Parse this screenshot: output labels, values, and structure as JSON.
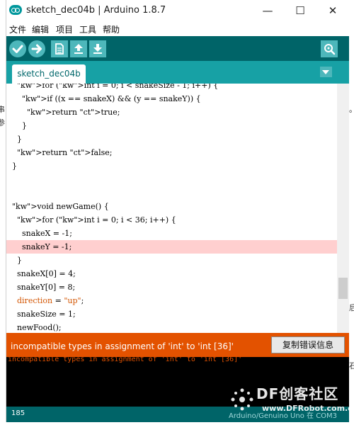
{
  "window": {
    "title": "sketch_dec04b | Arduino 1.8.7",
    "minimize_glyph": "—",
    "maximize_glyph": "☐",
    "close_glyph": "✕"
  },
  "menu": [
    "文件",
    "编辑",
    "项目",
    "工具",
    "帮助"
  ],
  "toolbar": {
    "icons": [
      "verify-icon",
      "upload-icon",
      "new-icon",
      "open-icon",
      "save-icon",
      "serial-monitor-icon"
    ],
    "accent_color": "#4db7bb",
    "background_color": "#006468"
  },
  "tab": {
    "label": "sketch_dec04b"
  },
  "editor": {
    "lines": [
      {
        "text": "  for (int i = 0; i < snakeSize - 1; i++) {",
        "highlight": false
      },
      {
        "text": "    if ((x == snakeX) && (y == snakeY)) {",
        "highlight": false
      },
      {
        "text": "      return true;",
        "highlight": false
      },
      {
        "text": "    }",
        "highlight": false
      },
      {
        "text": "  }",
        "highlight": false
      },
      {
        "text": "  return false;",
        "highlight": false
      },
      {
        "text": "}",
        "highlight": false
      },
      {
        "text": "",
        "highlight": false
      },
      {
        "text": "",
        "highlight": false
      },
      {
        "text": "void newGame() {",
        "highlight": false
      },
      {
        "text": "  for (int i = 0; i < 36; i++) {",
        "highlight": false
      },
      {
        "text": "    snakeX = -1;",
        "highlight": false
      },
      {
        "text": "    snakeY = -1;",
        "highlight": true
      },
      {
        "text": "  }",
        "highlight": false
      },
      {
        "text": "  snakeX[0] = 4;",
        "highlight": false
      },
      {
        "text": "  snakeY[0] = 8;",
        "highlight": false
      },
      {
        "text": "  direction = \"up\";",
        "highlight": false
      },
      {
        "text": "  snakeSize = 1;",
        "highlight": false
      },
      {
        "text": "  newFood();",
        "highlight": false
      }
    ],
    "highlight_color": "#ffcfcf"
  },
  "error": {
    "message": "incompatible types in assignment of 'int' to 'int [36]'",
    "copy_button_label": "复制错误信息",
    "color": "#e35200"
  },
  "console": {
    "text": "incompatible types in assignment of 'int' to 'int [36]'"
  },
  "status": {
    "line_number": "185",
    "board": "Arduino/Genuino Uno 在 COM3"
  },
  "watermark": {
    "brand": "DF创客社区",
    "url": "www.DFRobot.com.cn"
  },
  "background_page": {
    "left_glyphs": [
      "串",
      "参"
    ],
    "right_glyphs": [
      "。",
      "后",
      "石"
    ]
  }
}
